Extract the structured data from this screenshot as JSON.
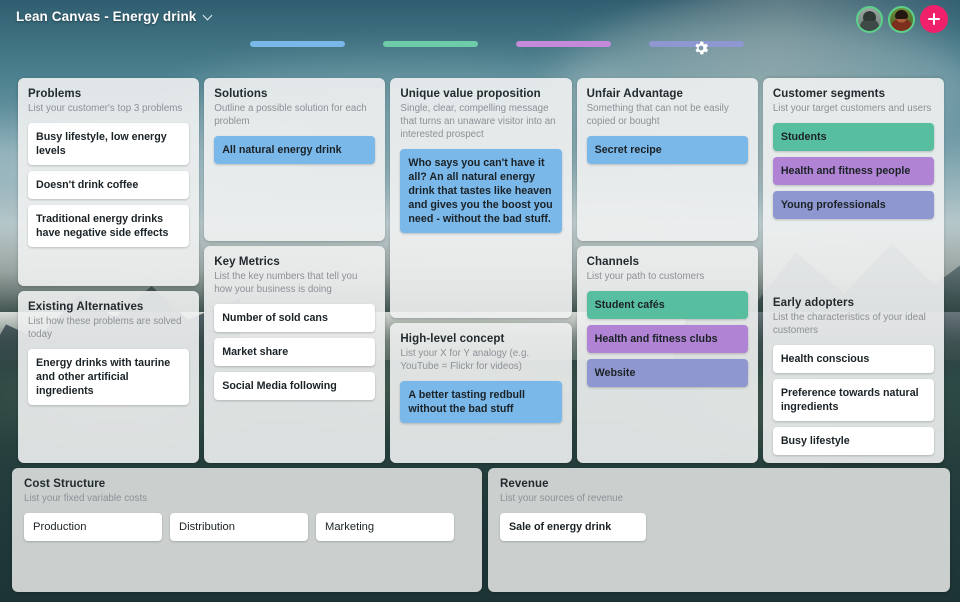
{
  "header": {
    "doc_title": "Lean Canvas - Energy drink",
    "chevron_icon": "chevron-down-icon",
    "gear_icon": "gear-icon",
    "add_button_icon": "plus-icon",
    "avatars": [
      {
        "name": "collaborator-1"
      },
      {
        "name": "collaborator-2"
      }
    ],
    "progress_pills": [
      {
        "color": "#7ab8ea"
      },
      {
        "color": "#6ecba8"
      },
      {
        "color": "#c489d8"
      },
      {
        "color": "#8f97d1"
      }
    ]
  },
  "columns": [
    {
      "sections": [
        {
          "title": "Problems",
          "subtitle": "List your customer's top 3 problems",
          "cards": [
            {
              "text": "Busy lifestyle, low energy levels",
              "color": "white"
            },
            {
              "text": "Doesn't drink coffee",
              "color": "white"
            },
            {
              "text": "Traditional energy drinks have negative side effects",
              "color": "white"
            }
          ]
        },
        {
          "title": "Existing Alternatives",
          "subtitle": "List how these problems are solved today",
          "cards": [
            {
              "text": "Energy drinks with taurine and other artificial ingredients",
              "color": "white"
            }
          ]
        }
      ]
    },
    {
      "sections": [
        {
          "title": "Solutions",
          "subtitle": "Outline a possible solution for each problem",
          "cards": [
            {
              "text": "All natural energy drink",
              "color": "blue"
            }
          ]
        },
        {
          "title": "Key Metrics",
          "subtitle": "List the key numbers that tell you how your business is doing",
          "cards": [
            {
              "text": "Number of sold cans",
              "color": "white"
            },
            {
              "text": "Market share",
              "color": "white"
            },
            {
              "text": "Social Media following",
              "color": "white"
            }
          ]
        }
      ]
    },
    {
      "sections": [
        {
          "title": "Unique value proposition",
          "subtitle": "Single, clear, compelling message that turns an unaware visitor into an interested prospect",
          "cards": [
            {
              "text": "Who says you can't have it all? An all natural energy drink that tastes like heaven and gives you the boost you need - without the bad stuff.",
              "color": "blue"
            }
          ]
        },
        {
          "title": "High-level concept",
          "subtitle": "List your X for Y analogy (e.g. YouTube = Flickr for videos)",
          "cards": [
            {
              "text": "A better tasting redbull without the bad stuff",
              "color": "blue"
            }
          ]
        }
      ]
    },
    {
      "sections": [
        {
          "title": "Unfair Advantage",
          "subtitle": "Something that can not be easily copied or bought",
          "cards": [
            {
              "text": "Secret recipe",
              "color": "blue"
            }
          ]
        },
        {
          "title": "Channels",
          "subtitle": "List your path to customers",
          "cards": [
            {
              "text": "Student cafés",
              "color": "green"
            },
            {
              "text": "Health and fitness clubs",
              "color": "purple"
            },
            {
              "text": "Website",
              "color": "peri"
            }
          ]
        }
      ]
    },
    {
      "sections": [
        {
          "title": "Customer segments",
          "subtitle": "List your target customers and users",
          "cards": [
            {
              "text": "Students",
              "color": "green"
            },
            {
              "text": "Health and fitness people",
              "color": "purple"
            },
            {
              "text": "Young professionals",
              "color": "peri"
            }
          ]
        },
        {
          "title": "Early adopters",
          "subtitle": "List the characteristics of your ideal customers",
          "cards": [
            {
              "text": "Health conscious",
              "color": "white"
            },
            {
              "text": "Preference towards natural ingredients",
              "color": "white"
            },
            {
              "text": "Busy lifestyle",
              "color": "white"
            }
          ]
        }
      ]
    }
  ],
  "bottom": {
    "cost": {
      "title": "Cost Structure",
      "subtitle": "List your fixed variable costs",
      "cards": [
        {
          "text": "Production"
        },
        {
          "text": "Distribution"
        },
        {
          "text": "Marketing"
        }
      ]
    },
    "revenue": {
      "title": "Revenue",
      "subtitle": "List your sources of revenue",
      "cards": [
        {
          "text": "Sale of energy drink"
        }
      ]
    }
  }
}
